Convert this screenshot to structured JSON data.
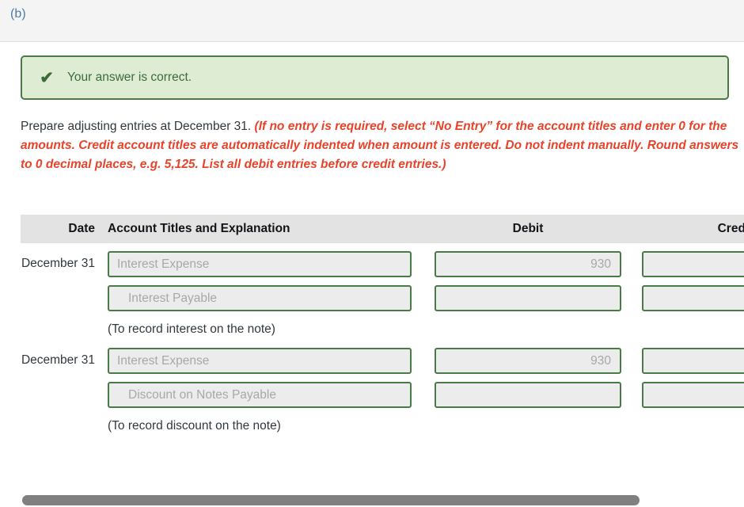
{
  "topbar": {
    "label": "(b)"
  },
  "banner": {
    "icon": "check-icon",
    "check_glyph": "✔",
    "message": "Your answer is correct.",
    "bg_color": "#dfecd4",
    "border_color": "#4a7a46",
    "text_color": "#3d6b3a"
  },
  "instructions": {
    "lead": "Prepare adjusting entries at December 31.",
    "emphasis": "(If no entry is required, select “No Entry” for the account titles and enter 0 for the amounts. Credit account titles are automatically indented when amount is entered. Do not indent manually. Round answers to 0 decimal places, e.g. 5,125. List all debit entries before credit entries.)",
    "emphasis_color": "#e8432a"
  },
  "table": {
    "headers": {
      "date": "Date",
      "account": "Account Titles and Explanation",
      "debit": "Debit",
      "credit": "Credit"
    },
    "header_bg": "#e3e3e3",
    "field_border_color": "#4a7a46",
    "field_bg_color": "#ececec",
    "field_text_color": "#a8a8a8",
    "entries": [
      {
        "date": "December 31",
        "lines": [
          {
            "account": "Interest Expense",
            "indented": false,
            "debit": "930",
            "credit": ""
          },
          {
            "account": "Interest Payable",
            "indented": true,
            "debit": "",
            "credit": ""
          }
        ],
        "memo": "(To record interest on the note)"
      },
      {
        "date": "December 31",
        "lines": [
          {
            "account": "Interest Expense",
            "indented": false,
            "debit": "930",
            "credit": ""
          },
          {
            "account": "Discount on Notes Payable",
            "indented": true,
            "debit": "",
            "credit": ""
          }
        ],
        "memo": "(To record discount on the note)"
      }
    ]
  },
  "scrollbar": {
    "orientation": "horizontal",
    "thumb_color": "#808080"
  }
}
